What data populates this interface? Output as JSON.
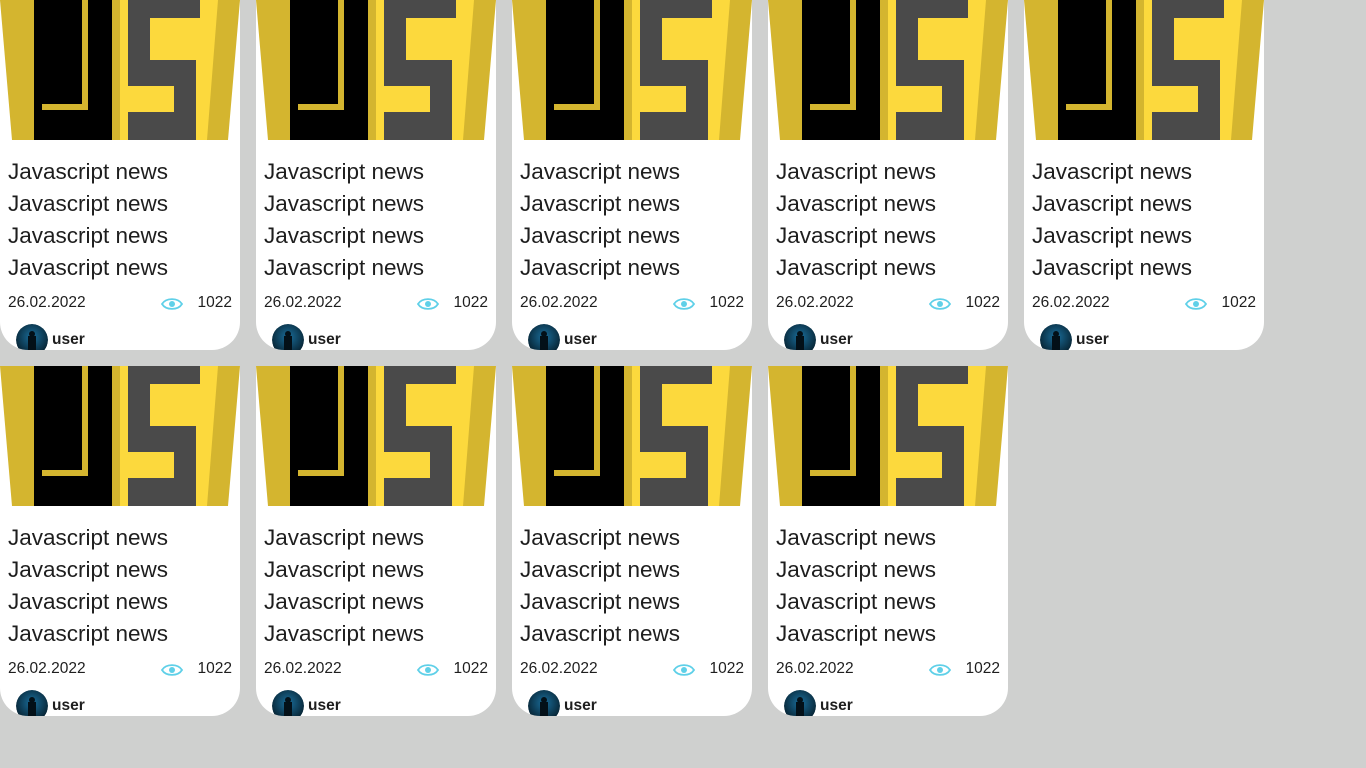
{
  "colors": {
    "page_background": "#cfd0cf",
    "card_background": "#ffffff",
    "logo_yellow": "#f5d742",
    "logo_dark": "#4a4a4a",
    "logo_black": "#000000",
    "eye_icon": "#5fd0e8"
  },
  "icons": {
    "thumbnail": "javascript-logo",
    "views": "eye-icon",
    "author": "avatar"
  },
  "cards": [
    {
      "title_lines": [
        "Javascript news",
        "Javascript news",
        "Javascript news",
        "Javascript news"
      ],
      "date": "26.02.2022",
      "views": "1022",
      "author": "user"
    },
    {
      "title_lines": [
        "Javascript news",
        "Javascript news",
        "Javascript news",
        "Javascript news"
      ],
      "date": "26.02.2022",
      "views": "1022",
      "author": "user"
    },
    {
      "title_lines": [
        "Javascript news",
        "Javascript news",
        "Javascript news",
        "Javascript news"
      ],
      "date": "26.02.2022",
      "views": "1022",
      "author": "user"
    },
    {
      "title_lines": [
        "Javascript news",
        "Javascript news",
        "Javascript news",
        "Javascript news"
      ],
      "date": "26.02.2022",
      "views": "1022",
      "author": "user"
    },
    {
      "title_lines": [
        "Javascript news",
        "Javascript news",
        "Javascript news",
        "Javascript news"
      ],
      "date": "26.02.2022",
      "views": "1022",
      "author": "user"
    },
    {
      "title_lines": [
        "Javascript news",
        "Javascript news",
        "Javascript news",
        "Javascript news"
      ],
      "date": "26.02.2022",
      "views": "1022",
      "author": "user"
    },
    {
      "title_lines": [
        "Javascript news",
        "Javascript news",
        "Javascript news",
        "Javascript news"
      ],
      "date": "26.02.2022",
      "views": "1022",
      "author": "user"
    },
    {
      "title_lines": [
        "Javascript news",
        "Javascript news",
        "Javascript news",
        "Javascript news"
      ],
      "date": "26.02.2022",
      "views": "1022",
      "author": "user"
    },
    {
      "title_lines": [
        "Javascript news",
        "Javascript news",
        "Javascript news",
        "Javascript news"
      ],
      "date": "26.02.2022",
      "views": "1022",
      "author": "user"
    }
  ]
}
